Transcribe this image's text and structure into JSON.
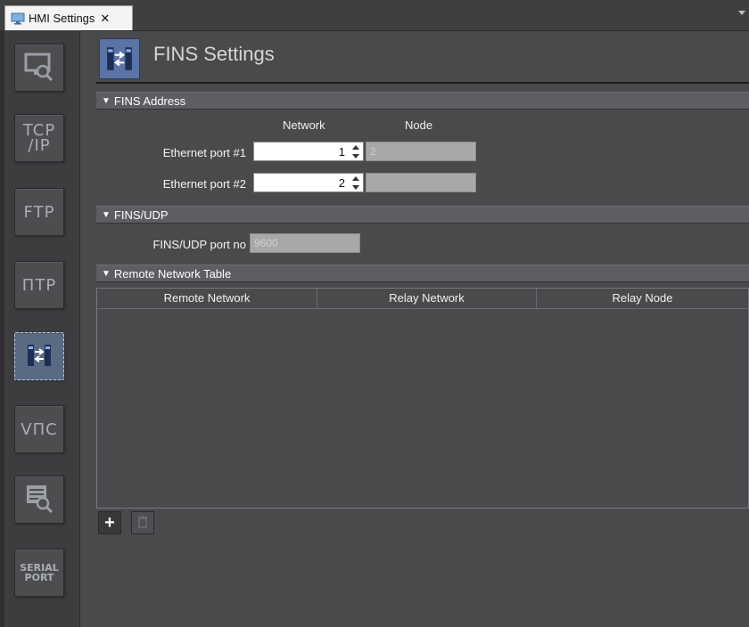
{
  "tab": {
    "title": "HMI Settings",
    "close": "✕"
  },
  "rail": [
    {
      "name": "display-settings",
      "icon": "monitor-magnifier-icon"
    },
    {
      "name": "tcpip",
      "text_line1": "TCP",
      "text_line2": "/IP"
    },
    {
      "name": "ftp",
      "text": "FTP"
    },
    {
      "name": "ntp",
      "text": "ΠTP"
    },
    {
      "name": "fins",
      "icon": "fins-arrows-icon",
      "active": true
    },
    {
      "name": "vnc",
      "text": "VΠC"
    },
    {
      "name": "device-settings",
      "icon": "server-magnifier-icon"
    },
    {
      "name": "serial-port",
      "text_line1": "SERIAL",
      "text_line2": "PORT"
    }
  ],
  "page": {
    "title": "FINS Settings"
  },
  "fins_address": {
    "section_label": "FINS Address",
    "col_network": "Network",
    "col_node": "Node",
    "rows": [
      {
        "label": "Ethernet port #1",
        "network": "1",
        "node": "2"
      },
      {
        "label": "Ethernet port #2",
        "network": "2",
        "node": ""
      }
    ]
  },
  "fins_udp": {
    "section_label": "FINS/UDP",
    "port_label": "FINS/UDP port no",
    "port_value": "9600"
  },
  "remote_table": {
    "section_label": "Remote Network Table",
    "columns": [
      "Remote Network",
      "Relay Network",
      "Relay Node"
    ],
    "add": "+",
    "delete": "🗑"
  },
  "colors": {
    "accent": "#5b74a6",
    "background": "#4a4a4d",
    "section": "#5e5e62"
  }
}
